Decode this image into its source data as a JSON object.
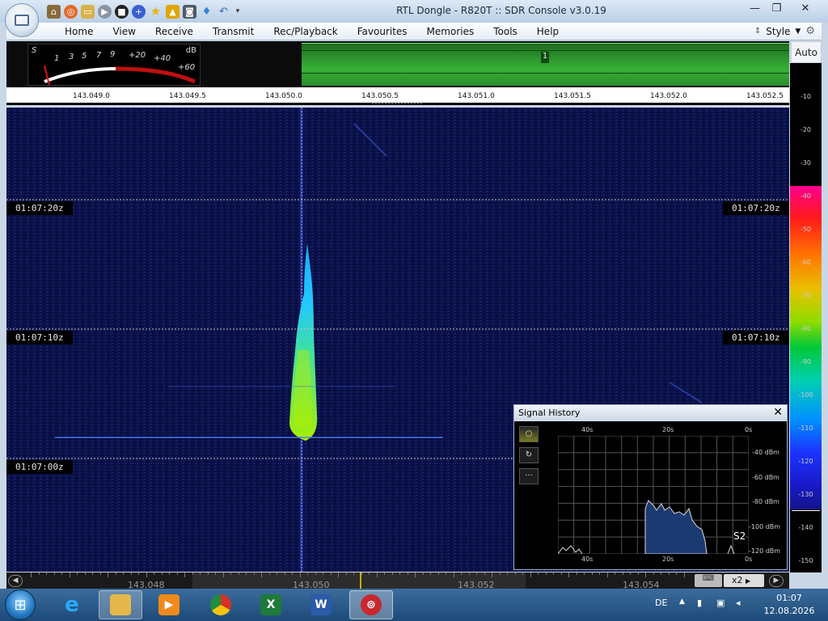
{
  "window": {
    "title": "RTL Dongle - R820T :: SDR Console v3.0.19",
    "controls": {
      "minimize": "—",
      "maximize": "❐",
      "close": "✕"
    }
  },
  "quick_access": [
    "home-icon",
    "lifebuoy-icon",
    "folder-icon",
    "play-icon",
    "stop-icon",
    "plus-icon",
    "star-icon",
    "lock-icon",
    "camera-icon",
    "drop-icon",
    "undo-icon",
    "dropdown-icon"
  ],
  "menu": {
    "items": [
      "Home",
      "View",
      "Receive",
      "Transmit",
      "Rec/Playback",
      "Favourites",
      "Memories",
      "Tools",
      "Help"
    ],
    "style_label": "Style"
  },
  "smeter": {
    "s_label": "S",
    "db_label": "dB",
    "scale": [
      "1",
      "3",
      "5",
      "7",
      "9",
      "+20",
      "+40",
      "+60"
    ]
  },
  "strip": {
    "marker": "1"
  },
  "auto_label": "Auto",
  "freq_scale": [
    "143.049.0",
    "143.049.5",
    "143.050.0",
    "143.050.5",
    "143.051.0",
    "143.051.5",
    "143.052.0",
    "143.052.5"
  ],
  "db_scale": [
    "-10",
    "-20",
    "-30",
    "-40",
    "-50",
    "-60",
    "-70",
    "-80",
    "-90",
    "-100",
    "-110",
    "-120",
    "-130",
    "-140",
    "-150"
  ],
  "waterfall": {
    "times": [
      "01:07:20z",
      "01:07:10z",
      "01:07:00z"
    ]
  },
  "signal_history": {
    "title": "Signal History",
    "close": "✕",
    "buttons": [
      "○",
      "↻",
      "···"
    ],
    "top_axis": [
      "40s",
      "20s",
      "0s"
    ],
    "bottom_axis": [
      "40s",
      "20s",
      "0s"
    ],
    "dbm_axis": [
      "-40 dBm",
      "-60 dBm",
      "-80 dBm",
      "-100 dBm",
      "-120 dBm"
    ],
    "s_reading": "S2"
  },
  "bottom_scale": [
    "143.048",
    "143.050",
    "143.052",
    "143.054"
  ],
  "bottom_controls": {
    "zoom": "x2"
  },
  "taskbar": {
    "apps": [
      "internet-explorer",
      "file-explorer",
      "media-player",
      "chrome",
      "excel",
      "word",
      "sdr-console"
    ],
    "lang": "DE",
    "time": "01:07",
    "date": "12.08.2026"
  }
}
